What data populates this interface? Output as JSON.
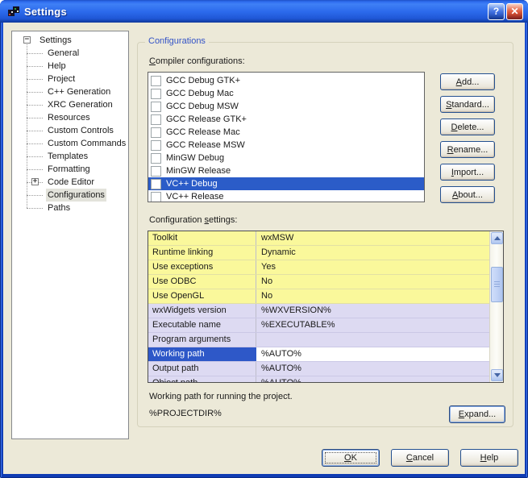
{
  "window": {
    "title": "Settings"
  },
  "titlebar": {
    "help_glyph": "?",
    "close_glyph": "✕"
  },
  "tree": {
    "root": "Settings",
    "items": [
      "General",
      "Help",
      "Project",
      "C++ Generation",
      "XRC Generation",
      "Resources",
      "Custom Controls",
      "Custom Commands",
      "Templates",
      "Formatting",
      "Code Editor",
      "Configurations",
      "Paths"
    ],
    "selected": "Configurations"
  },
  "configurations_group": {
    "title": "Configurations",
    "compiler_list": {
      "label": "Compiler configurations:",
      "items": [
        "GCC Debug GTK+",
        "GCC Debug Mac",
        "GCC Debug MSW",
        "GCC Release GTK+",
        "GCC Release Mac",
        "GCC Release MSW",
        "MinGW Debug",
        "MinGW Release",
        "VC++ Debug",
        "VC++ Release"
      ],
      "selected": "VC++ Debug"
    },
    "buttons": [
      "Add...",
      "Standard...",
      "Delete...",
      "Rename...",
      "Import...",
      "About..."
    ],
    "settings_table": {
      "label": "Configuration settings:",
      "selected_row": "Working path",
      "rows": [
        {
          "name": "Toolkit",
          "value": "wxMSW"
        },
        {
          "name": "Runtime linking",
          "value": "Dynamic"
        },
        {
          "name": "Use exceptions",
          "value": "Yes"
        },
        {
          "name": "Use ODBC",
          "value": "No"
        },
        {
          "name": "Use OpenGL",
          "value": "No"
        },
        {
          "name": "wxWidgets version",
          "value": "%WXVERSION%"
        },
        {
          "name": "Executable name",
          "value": "%EXECUTABLE%"
        },
        {
          "name": "Program arguments",
          "value": ""
        },
        {
          "name": "Working path",
          "value": "%AUTO%"
        },
        {
          "name": "Output path",
          "value": "%AUTO%"
        },
        {
          "name": "Object path",
          "value": "%AUTO%"
        }
      ]
    },
    "detail": {
      "description": "Working path for running the project.",
      "value": "%PROJECTDIR%",
      "expand_button": "Expand..."
    }
  },
  "footer": {
    "ok": "OK",
    "cancel": "Cancel",
    "help": "Help"
  },
  "colors": {
    "dialog_bg": "#ECE9D8",
    "titlebar_blue": "#2E6CEE",
    "selection_blue": "#2B5CC8",
    "row_yellow": "#FAF89B",
    "row_lavender": "#DDDAF2",
    "groupbox_label": "#3353C6"
  }
}
